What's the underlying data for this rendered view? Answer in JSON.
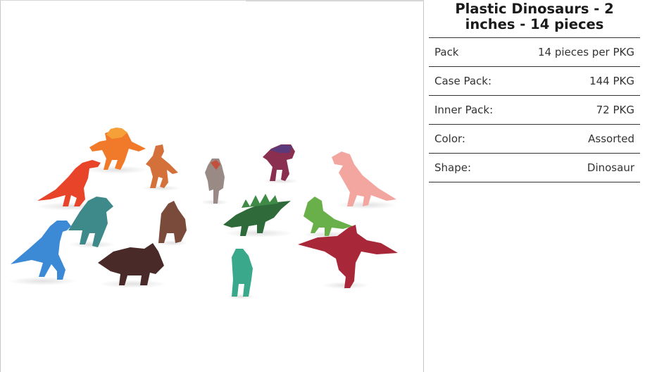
{
  "product": {
    "title": "Plastic Dinosaurs - 2 inches - 14 pieces",
    "image_alt": "Assorted plastic toy dinosaurs"
  },
  "specs": [
    {
      "label": "Pack",
      "value": "14 pieces per PKG"
    },
    {
      "label": "Case Pack:",
      "value": "144 PKG"
    },
    {
      "label": "Inner Pack:",
      "value": "72 PKG"
    },
    {
      "label": "Color:",
      "value": "Assorted"
    },
    {
      "label": "Shape:",
      "value": "Dinosaur"
    }
  ]
}
